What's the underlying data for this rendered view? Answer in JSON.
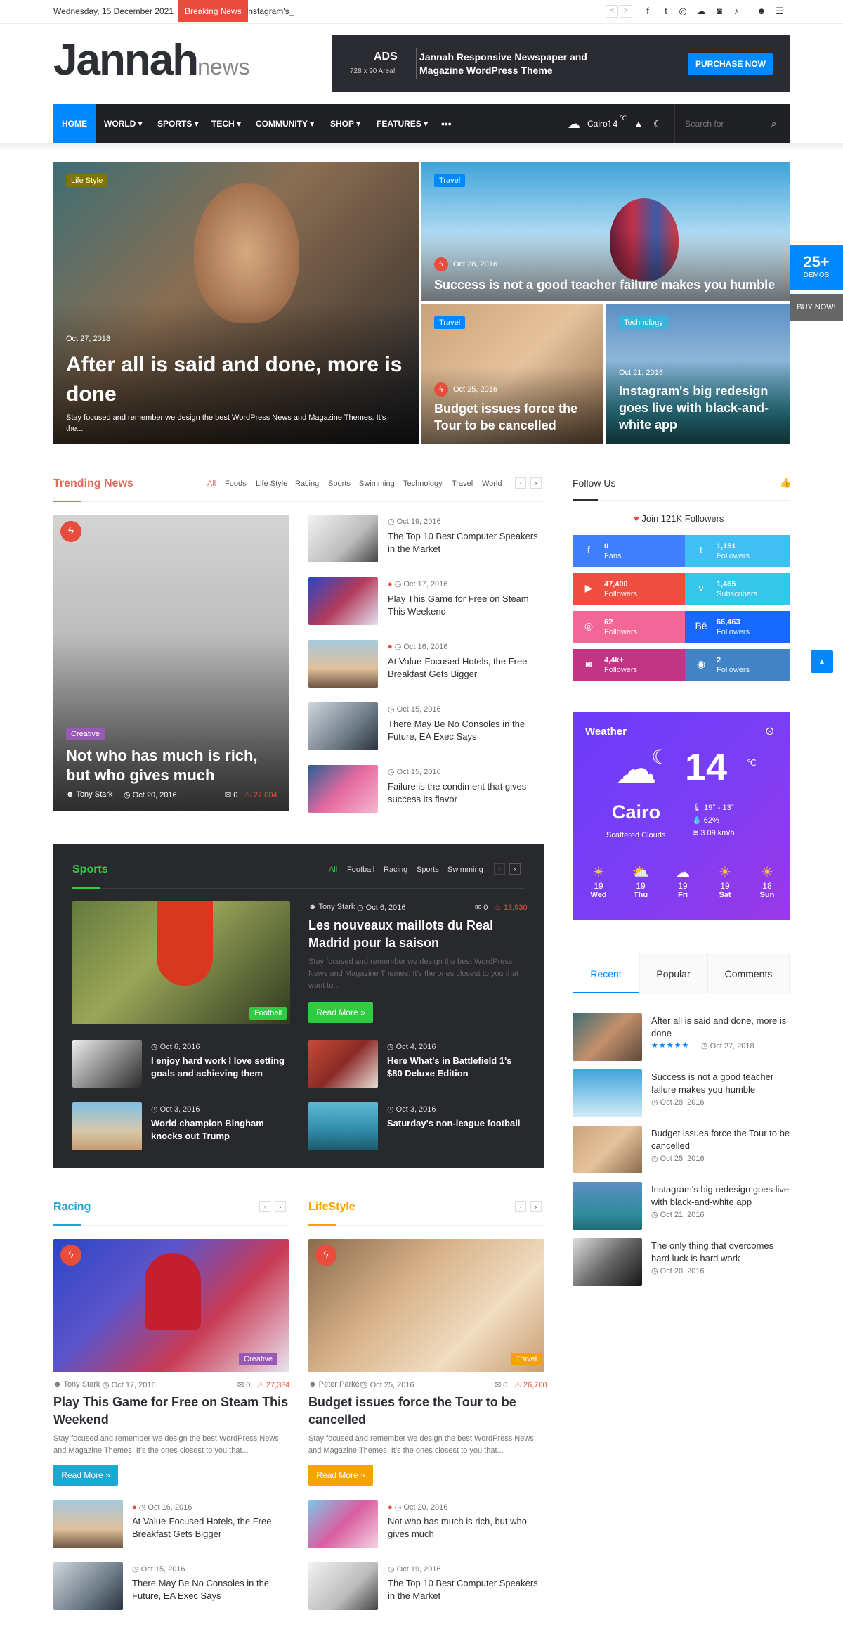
{
  "topbar": {
    "date": "Wednesday, 15 December 2021",
    "breaking_label": "Breaking News",
    "breaking_text": "Instagram's_",
    "prev": "<",
    "next": ">"
  },
  "social_icons": [
    "facebook-icon",
    "twitter-icon",
    "dribbble-icon",
    "soundcloud-icon",
    "instagram-icon",
    "tiktok-icon",
    "user-icon",
    "menu-icon"
  ],
  "logo": {
    "main": "Jannah",
    "sub": "news"
  },
  "ad": {
    "title": "ADS",
    "size": "728 x 90 Area!",
    "text": "Jannah Responsive Newspaper and Magazine WordPress Theme",
    "button": "PURCHASE NOW"
  },
  "nav": {
    "items": [
      "HOME",
      "WORLD",
      "SPORTS",
      "TECH",
      "COMMUNITY",
      "SHOP",
      "FEATURES"
    ],
    "more": "•••",
    "weather": "Cairo",
    "temp": "14",
    "unit": "℃",
    "search_placeholder": "Search for"
  },
  "side_badge": {
    "count": "25+",
    "label": "DEMOS",
    "buy": "BUY NOW!"
  },
  "hero": [
    {
      "cat": "Life Style",
      "date": "Oct 27, 2018",
      "title": "After all is said and done, more is done",
      "excerpt": "Stay focused and remember we design the best WordPress News and Magazine Themes. It's the..."
    },
    {
      "cat": "Travel",
      "date": "Oct 28, 2016",
      "title": "Success is not a good teacher failure makes you humble"
    },
    {
      "cat": "Travel",
      "date": "Oct 25, 2016",
      "title": "Budget issues force the Tour to be cancelled"
    },
    {
      "cat": "Technology",
      "date": "Oct 21, 2016",
      "title": "Instagram's big redesign goes live with black-and-white app"
    }
  ],
  "trending": {
    "title": "Trending News",
    "filters": [
      "All",
      "Foods",
      "Life Style",
      "Racing",
      "Sports",
      "Swimming",
      "Technology",
      "Travel",
      "World"
    ],
    "main": {
      "cat": "Creative",
      "title": "Not who has much is rich, but who gives much",
      "author": "Tony Stark",
      "date": "Oct 20, 2016",
      "comments": "0",
      "views": "27,004"
    },
    "items": [
      {
        "date": "Oct 19, 2016",
        "title": "The Top 10 Best Computer Speakers in the Market"
      },
      {
        "date": "Oct 17, 2016",
        "title": "Play This Game for Free on Steam This Weekend"
      },
      {
        "date": "Oct 16, 2016",
        "title": "At Value-Focused Hotels, the Free Breakfast Gets Bigger"
      },
      {
        "date": "Oct 15, 2016",
        "title": "There May Be No Consoles in the Future, EA Exec Says"
      },
      {
        "date": "Oct 15, 2016",
        "title": "Failure is the condiment that gives success its flavor"
      }
    ]
  },
  "follow": {
    "title": "Follow Us",
    "join": "Join 121K Followers",
    "items": [
      {
        "icon": "facebook-icon",
        "n": "0",
        "l": "Fans",
        "color": "#4080ff"
      },
      {
        "icon": "twitter-icon",
        "n": "1,151",
        "l": "Followers",
        "color": "#40bff5"
      },
      {
        "icon": "youtube-icon",
        "n": "47,400",
        "l": "Followers",
        "color": "#ef4e41"
      },
      {
        "icon": "vimeo-icon",
        "n": "1,465",
        "l": "Subscribers",
        "color": "#35c6ea"
      },
      {
        "icon": "dribbble-icon",
        "n": "62",
        "l": "Followers",
        "color": "#f26798"
      },
      {
        "icon": "behance-icon",
        "n": "66,463",
        "l": "Followers",
        "color": "#1769ff"
      },
      {
        "icon": "instagram-icon",
        "n": "4,4k+",
        "l": "Followers",
        "color": "#c13584"
      },
      {
        "icon": "github-icon",
        "n": "2",
        "l": "Followers",
        "color": "#4183c4"
      }
    ]
  },
  "weather": {
    "title": "Weather",
    "city": "Cairo",
    "desc": "Scattered Clouds",
    "temp": "14",
    "unit": "℃",
    "range": "19° - 13°",
    "humidity": "62%",
    "wind": "3.09 km/h",
    "days": [
      {
        "t": "19",
        "d": "Wed"
      },
      {
        "t": "19",
        "d": "Thu"
      },
      {
        "t": "19",
        "d": "Fri"
      },
      {
        "t": "19",
        "d": "Sat"
      },
      {
        "t": "18",
        "d": "Sun"
      }
    ]
  },
  "sports": {
    "title": "Sports",
    "filters": [
      "All",
      "Football",
      "Racing",
      "Sports",
      "Swimming"
    ],
    "main": {
      "cat": "Football",
      "author": "Tony Stark",
      "date": "Oct 6, 2016",
      "comments": "0",
      "views": "13,930",
      "title": "Les nouveaux maillots du Real Madrid pour la saison",
      "excerpt": "Stay focused and remember we design the best WordPress News and Magazine Themes. It's the ones closest to you that want to...",
      "button": "Read More »"
    },
    "items": [
      {
        "date": "Oct 6, 2016",
        "title": "I enjoy hard work I love setting goals and achieving them"
      },
      {
        "date": "Oct 4, 2016",
        "title": "Here What's in Battlefield 1's $80 Deluxe Edition"
      },
      {
        "date": "Oct 3, 2016",
        "title": "World champion Bingham knocks out Trump"
      },
      {
        "date": "Oct 3, 2016",
        "title": "Saturday's non-league football"
      }
    ]
  },
  "tabs": {
    "items": [
      "Recent",
      "Popular",
      "Comments"
    ],
    "posts": [
      {
        "title": "After all is said and done, more is done",
        "date": "Oct 27, 2018",
        "stars": "★★★★★"
      },
      {
        "title": "Success is not a good teacher failure makes you humble",
        "date": "Oct 28, 2016"
      },
      {
        "title": "Budget issues force the Tour to be cancelled",
        "date": "Oct 25, 2016"
      },
      {
        "title": "Instagram's big redesign goes live with black-and-white app",
        "date": "Oct 21, 2016"
      },
      {
        "title": "The only thing that overcomes hard luck is hard work",
        "date": "Oct 20, 2016"
      }
    ]
  },
  "racing": {
    "title": "Racing",
    "cat": "Creative",
    "author": "Tony Stark",
    "date": "Oct 17, 2016",
    "comments": "0",
    "views": "27,334",
    "post_title": "Play This Game for Free on Steam This Weekend",
    "excerpt": "Stay focused and remember we design the best WordPress News and Magazine Themes. It's the ones closest to you that...",
    "button": "Read More »",
    "items": [
      {
        "date": "Oct 16, 2016",
        "title": "At Value-Focused Hotels, the Free Breakfast Gets Bigger"
      },
      {
        "date": "Oct 15, 2016",
        "title": "There May Be No Consoles in the Future, EA Exec Says"
      }
    ]
  },
  "lifestyle": {
    "title": "LifeStyle",
    "cat": "Travel",
    "author": "Peter Parker",
    "date": "Oct 25, 2016",
    "comments": "0",
    "views": "26,700",
    "post_title": "Budget issues force the Tour to be cancelled",
    "excerpt": "Stay focused and remember we design the best WordPress News and Magazine Themes. It's the ones closest to you that...",
    "button": "Read More »",
    "items": [
      {
        "date": "Oct 20, 2016",
        "title": "Not who has much is rich, but who gives much"
      },
      {
        "date": "Oct 19, 2016",
        "title": "The Top 10 Best Computer Speakers in the Market"
      }
    ]
  },
  "colors": {
    "accent": "#0088ff",
    "trending": "#e06c5c",
    "sports": "#2ecc40",
    "racing": "#1ea7d1",
    "lifestyle": "#f5a300"
  }
}
